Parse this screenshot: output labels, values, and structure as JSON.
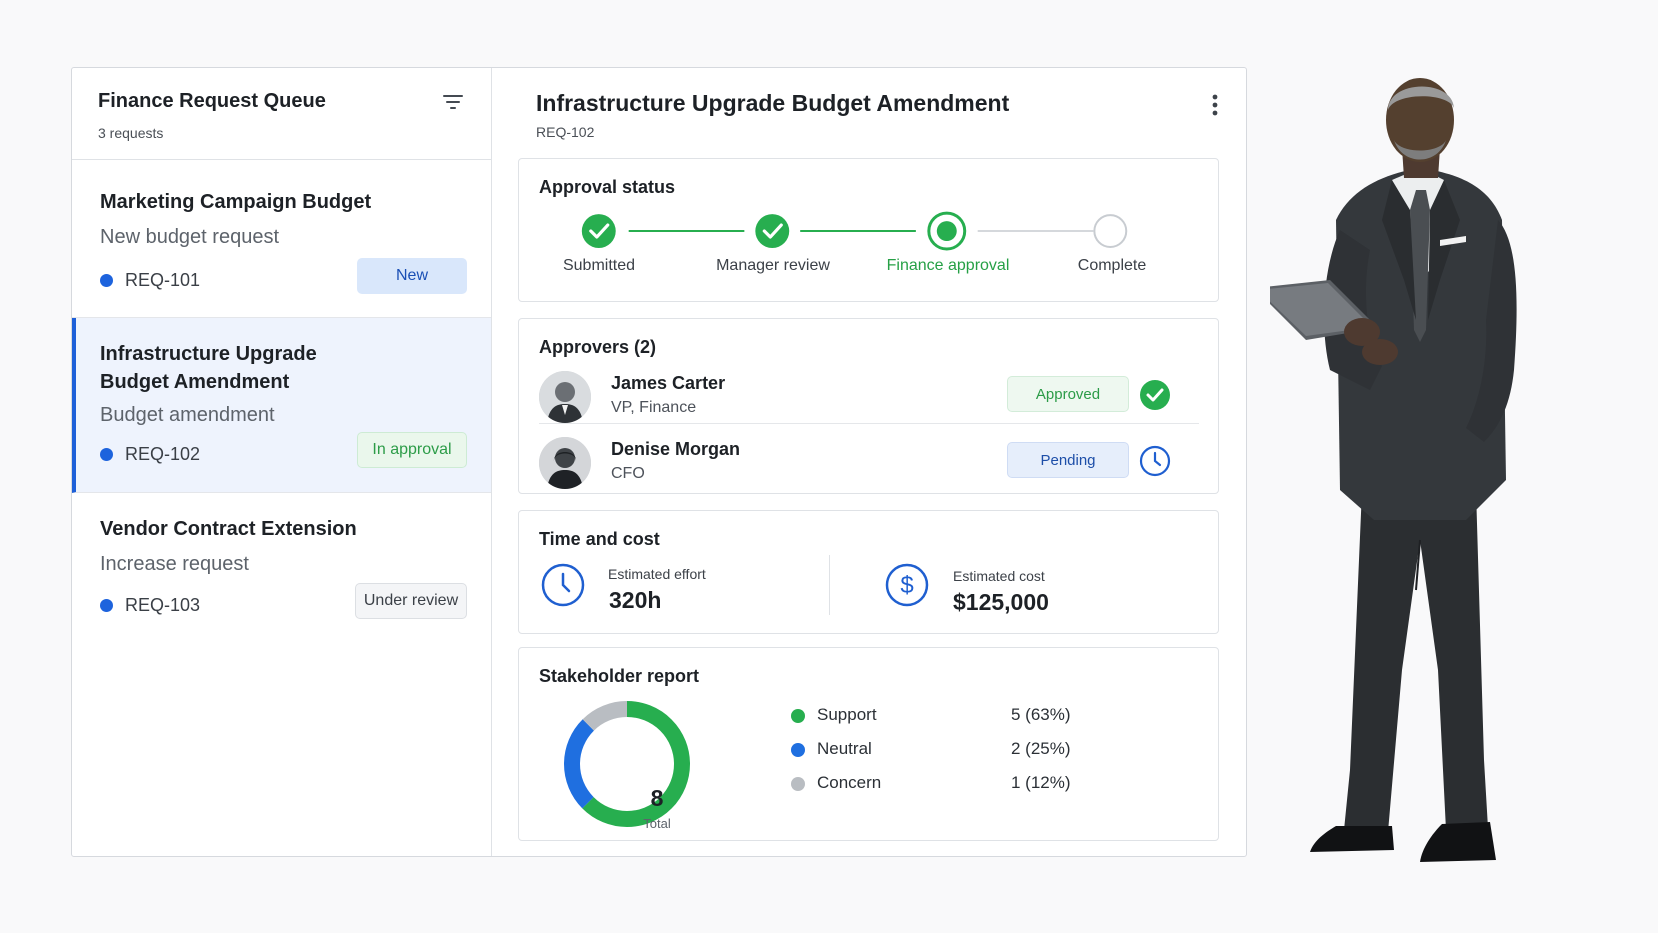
{
  "queue": {
    "title": "Finance Request Queue",
    "count_label": "3 requests",
    "requests": [
      {
        "title": "Marketing Campaign Budget",
        "type": "New budget request",
        "id": "REQ-101",
        "status": "New"
      },
      {
        "title": "Infrastructure Upgrade Budget Amendment",
        "title_line1": "Infrastructure Upgrade",
        "title_line2": "Budget Amendment",
        "type": "Budget amendment",
        "id": "REQ-102",
        "status": "In approval"
      },
      {
        "title": "Vendor Contract Extension",
        "type": "Increase request",
        "id": "REQ-103",
        "status": "Under review"
      }
    ]
  },
  "detail": {
    "title": "Infrastructure Upgrade Budget Amendment",
    "id": "REQ-102",
    "approval_status": {
      "heading": "Approval status",
      "steps": [
        {
          "label": "Submitted",
          "state": "done"
        },
        {
          "label": "Manager review",
          "state": "done"
        },
        {
          "label": "Finance approval",
          "state": "current"
        },
        {
          "label": "Complete",
          "state": "pending"
        }
      ]
    },
    "approvers": {
      "heading": "Approvers (2)",
      "list": [
        {
          "name": "James Carter",
          "role": "VP, Finance",
          "status": "Approved",
          "icon": "check-circle-icon"
        },
        {
          "name": "Denise Morgan",
          "role": "CFO",
          "status": "Pending",
          "icon": "clock-icon"
        }
      ]
    },
    "time_cost": {
      "heading": "Time and cost",
      "effort_label": "Estimated effort",
      "effort_value": "320h",
      "cost_label": "Estimated cost",
      "cost_value": "$125,000"
    },
    "stakeholder_report": {
      "heading": "Stakeholder report",
      "total": "8",
      "total_label": "Total",
      "segments": [
        {
          "name": "Support",
          "count": 5,
          "display": "5 (63%)",
          "color": "#27ae4f"
        },
        {
          "name": "Neutral",
          "count": 2,
          "display": "2 (25%)",
          "color": "#1f6fe0"
        },
        {
          "name": "Concern",
          "count": 1,
          "display": "1 (12%)",
          "color": "#b9bdc2"
        }
      ]
    }
  },
  "colors": {
    "accent": "#1d5fd8",
    "success": "#27ae4f"
  }
}
